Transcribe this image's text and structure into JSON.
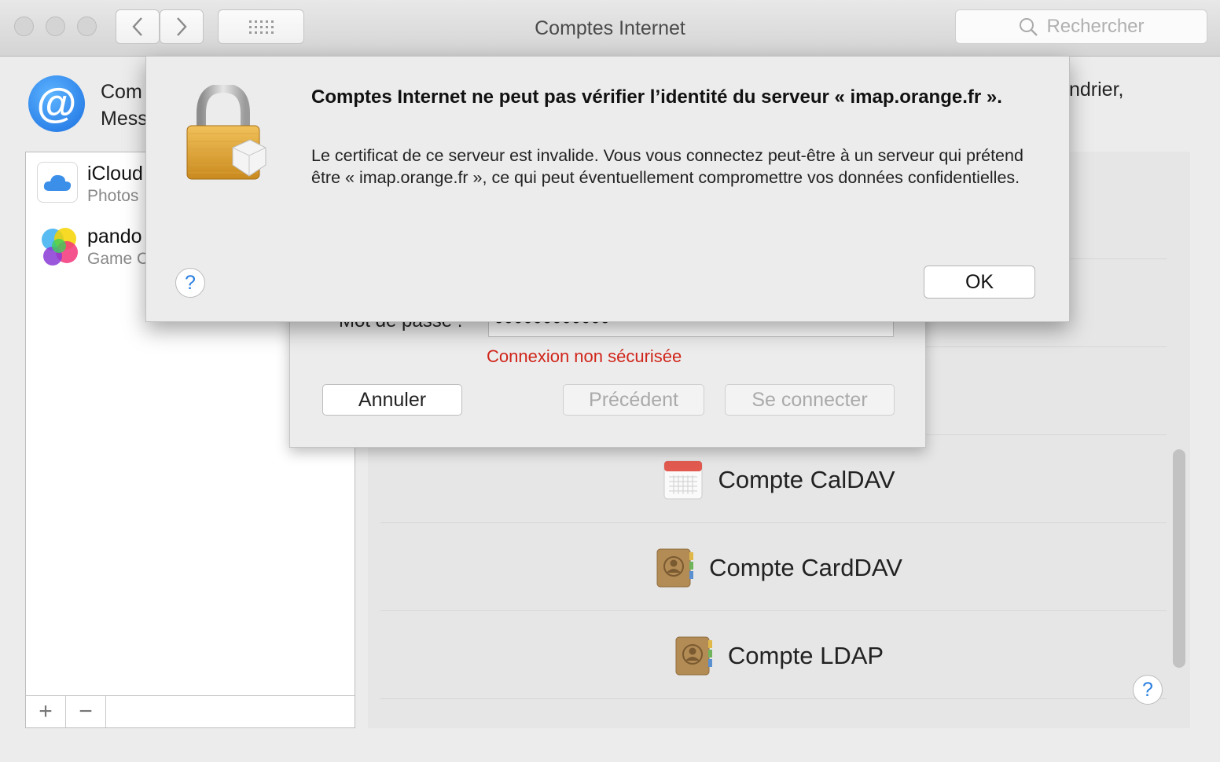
{
  "window": {
    "title": "Comptes Internet",
    "search_placeholder": "Rechercher"
  },
  "header": {
    "desc_left_line1": "Com",
    "desc_left_line2": "Mess",
    "desc_right": "ndrier,"
  },
  "sidebar": {
    "accounts": [
      {
        "name": "iCloud",
        "sub": "Photos"
      },
      {
        "name": "pando",
        "sub": "Game C"
      }
    ],
    "add_label": "+",
    "remove_label": "−"
  },
  "providers": [
    {
      "label": "Compte CalDAV",
      "icon": "calendar-icon"
    },
    {
      "label": "Compte CardDAV",
      "icon": "contacts-icon"
    },
    {
      "label": "Compte LDAP",
      "icon": "contacts-icon"
    }
  ],
  "sheet": {
    "password_label": "Mot de passe :",
    "password_value": "●●●●●●●●●●●●",
    "warning": "Connexion non sécurisée",
    "cancel_label": "Annuler",
    "previous_label": "Précédent",
    "connect_label": "Se connecter"
  },
  "alert": {
    "title": "Comptes Internet ne peut pas vérifier l’identité du serveur « imap.orange.fr ».",
    "message": "Le certificat de ce serveur est invalide. Vous vous connectez peut-être à un serveur qui prétend être « imap.orange.fr », ce qui peut éventuellement compromettre vos données confidentielles.",
    "ok_label": "OK",
    "help_label": "?"
  },
  "help_label": "?",
  "colors": {
    "warning": "#d0251a",
    "accent": "#2a7fe0"
  }
}
